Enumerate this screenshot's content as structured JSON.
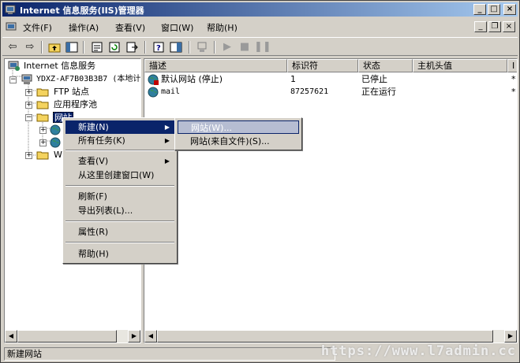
{
  "window": {
    "title": "Internet 信息服务(IIS)管理器"
  },
  "menubar": {
    "items": [
      {
        "label": "文件(F)"
      },
      {
        "label": "操作(A)"
      },
      {
        "label": "查看(V)"
      },
      {
        "label": "窗口(W)"
      },
      {
        "label": "帮助(H)"
      }
    ]
  },
  "toolbar": {
    "icons": [
      "back-icon",
      "forward-icon",
      "up-folder-icon",
      "show-tree-icon",
      "properties-icon",
      "refresh-icon",
      "export-icon",
      "help-icon",
      "console-icon",
      "computer-icon",
      "play-icon",
      "stop-icon",
      "pause-icon"
    ]
  },
  "tree": {
    "items": [
      {
        "label": "Internet 信息服务"
      },
      {
        "label": "YDXZ-AF7B03B3B7 (本地计"
      },
      {
        "label": "FTP 站点"
      },
      {
        "label": "应用程序池"
      },
      {
        "label": "网站"
      },
      {
        "label": "We"
      }
    ]
  },
  "list": {
    "headers": [
      "描述",
      "标识符",
      "状态",
      "主机头值",
      "I"
    ],
    "rows": [
      {
        "desc": "默认网站 (停止)",
        "id": "1",
        "status": "已停止",
        "host": "",
        "extra": "*"
      },
      {
        "desc": "mail",
        "id": "87257621",
        "status": "正在运行",
        "host": "",
        "extra": "*"
      }
    ]
  },
  "context_menu": {
    "items": [
      {
        "label": "新建(N)"
      },
      {
        "label": "所有任务(K)"
      },
      {
        "label": "查看(V)"
      },
      {
        "label": "从这里创建窗口(W)"
      },
      {
        "label": "刷新(F)"
      },
      {
        "label": "导出列表(L)..."
      },
      {
        "label": "属性(R)"
      },
      {
        "label": "帮助(H)"
      }
    ]
  },
  "submenu": {
    "items": [
      {
        "label": "网站(W)..."
      },
      {
        "label": "网站(来自文件)(S)..."
      }
    ]
  },
  "statusbar": {
    "text": "新建网站"
  },
  "watermark": "https://www.l7admin.cc",
  "colors": {
    "title_start": "#0a246a",
    "title_end": "#a6caf0",
    "selection": "#0a246a"
  }
}
